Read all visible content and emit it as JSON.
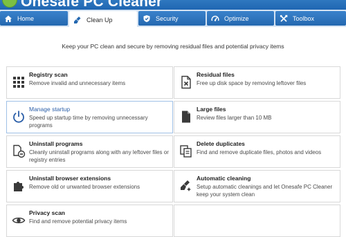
{
  "app": {
    "title": "Onesafe PC Cleaner"
  },
  "tabs": [
    {
      "label": "Home",
      "icon": "home-icon"
    },
    {
      "label": "Clean Up",
      "icon": "broom-icon",
      "active": true
    },
    {
      "label": "Security",
      "icon": "shield-icon"
    },
    {
      "label": "Optimize",
      "icon": "speedometer-icon"
    },
    {
      "label": "Toolbox",
      "icon": "tools-icon"
    }
  ],
  "main": {
    "subtitle": "Keep your PC clean and secure by removing residual files and potential privacy items",
    "cards": [
      {
        "title": "Registry scan",
        "desc": "Remove invalid and unnecessary items",
        "icon": "grid-icon"
      },
      {
        "title": "Residual files",
        "desc": "Free up disk space by removing leftover files",
        "icon": "file-x-icon"
      },
      {
        "title": "Manage startup",
        "desc": "Speed up startup time by removing unnecessary programs",
        "icon": "power-icon"
      },
      {
        "title": "Large files",
        "desc": "Review files larger than 10 MB",
        "icon": "file-icon"
      },
      {
        "title": "Uninstall programs",
        "desc": "Cleanly uninstall programs along with any leftover files or registry entries",
        "icon": "uninstall-icon"
      },
      {
        "title": "Delete duplicates",
        "desc": "Find and remove duplicate files, photos and videos",
        "icon": "duplicate-icon"
      },
      {
        "title": "Uninstall browser extensions",
        "desc": "Remove old or unwanted browser extensions",
        "icon": "puzzle-icon"
      },
      {
        "title": "Automatic cleaning",
        "desc": "Setup automatic cleanings and let Onesafe PC Cleaner keep your system clean",
        "icon": "auto-clean-icon"
      },
      {
        "title": "Privacy scan",
        "desc": "Find and remove potential privacy items",
        "icon": "eye-icon"
      }
    ]
  },
  "colors": {
    "accent": "#2468b0",
    "tab_bar": "#d5e3f3",
    "active_title": "#2a5ea8"
  }
}
